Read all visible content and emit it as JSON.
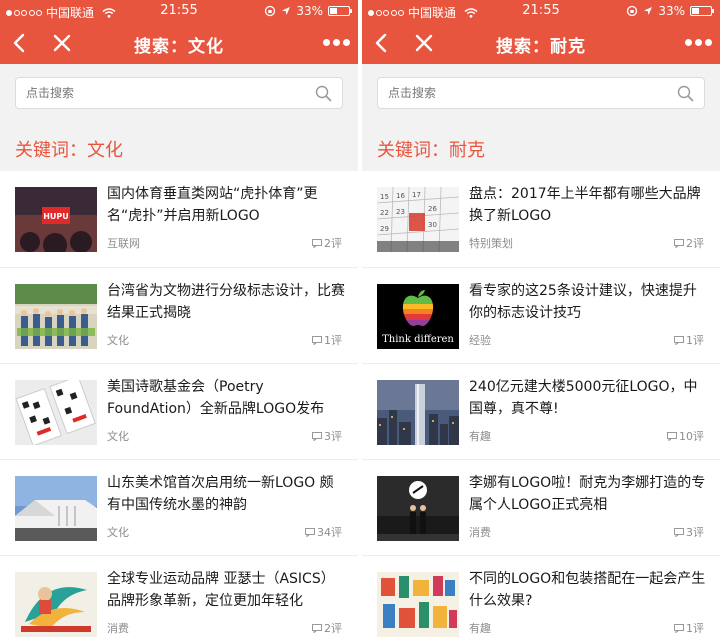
{
  "colors": {
    "accent": "#e8553e",
    "background": "#f2f2f2"
  },
  "screens": [
    {
      "status": {
        "carrier": "中国联通",
        "time": "21:55",
        "battery": "33%",
        "battery_level": 0.33
      },
      "nav": {
        "title": "搜索：文化"
      },
      "search": {
        "placeholder": "点击搜索"
      },
      "keyword_label": "关键词：文化",
      "items": [
        {
          "title": "国内体育垂直类网站“虎扑体育”更名“虎扑”并启用新LOGO",
          "category": "互联网",
          "comments": "2评",
          "thumb_text": "HUPU",
          "thumb": "hupu"
        },
        {
          "title": "台湾省为文物进行分级标志设计，比赛结果正式揭晓",
          "category": "文化",
          "comments": "1评",
          "thumb": "group"
        },
        {
          "title": "美国诗歌基金会（Poetry FoundAtion）全新品牌LOGO发布",
          "category": "文化",
          "comments": "3评",
          "thumb": "poetry"
        },
        {
          "title": "山东美术馆首次启用统一新LOGO 颇有中国传统水墨的神韵",
          "category": "文化",
          "comments": "34评",
          "thumb": "museum"
        },
        {
          "title": "全球专业运动品牌 亚瑟士（ASICS）品牌形象革新，定位更加年轻化",
          "category": "消费",
          "comments": "2评",
          "thumb": "asics"
        }
      ]
    },
    {
      "status": {
        "carrier": "中国联通",
        "time": "21:55",
        "battery": "33%",
        "battery_level": 0.33
      },
      "nav": {
        "title": "搜索：耐克"
      },
      "search": {
        "placeholder": "点击搜索"
      },
      "keyword_label": "关键词：耐克",
      "items": [
        {
          "title": "盘点：2017年上半年都有哪些大品牌换了新LOGO",
          "category": "特别策划",
          "comments": "2评",
          "thumb": "calendar"
        },
        {
          "title": "看专家的这25条设计建议，快速提升你的标志设计技巧",
          "category": "经验",
          "comments": "1评",
          "thumb_text": "Think differen",
          "thumb": "apple"
        },
        {
          "title": "240亿元建大楼5000元征LOGO，中国尊，真不尊!",
          "category": "有趣",
          "comments": "10评",
          "thumb": "tower"
        },
        {
          "title": "李娜有LOGO啦！耐克为李娜打造的专属个人LOGO正式亮相",
          "category": "消费",
          "comments": "3评",
          "thumb": "lina"
        },
        {
          "title": "不同的LOGO和包装搭配在一起会产生什么效果?",
          "category": "有趣",
          "comments": "1评",
          "thumb": "packaging"
        }
      ]
    }
  ]
}
